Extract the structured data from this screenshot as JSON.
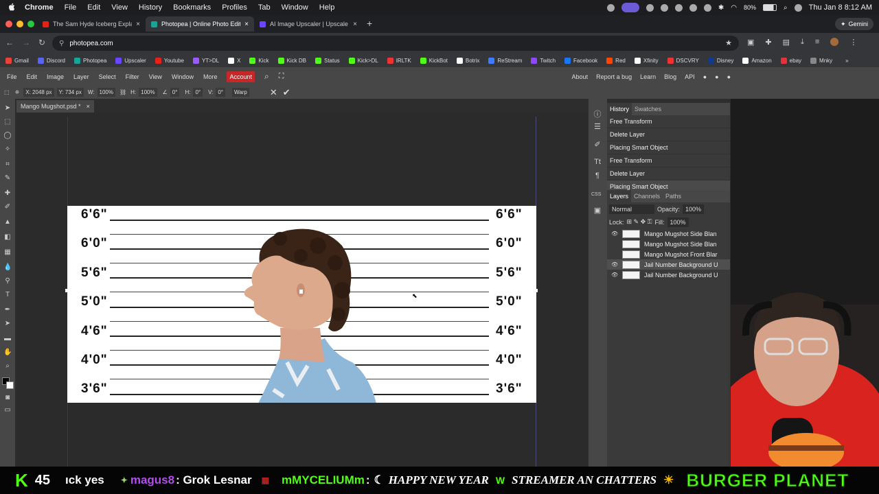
{
  "mac_menubar": {
    "app": "Chrome",
    "items": [
      "File",
      "Edit",
      "View",
      "History",
      "Bookmarks",
      "Profiles",
      "Tab",
      "Window",
      "Help"
    ],
    "battery": "80%",
    "clock": "Thu Jan 8  8:12 AM"
  },
  "browser": {
    "tabs": [
      {
        "label": "The Sam Hyde Iceberg Explai",
        "active": false
      },
      {
        "label": "Photopea | Online Photo Edito",
        "active": true
      },
      {
        "label": "AI Image Upscaler | Upscale i",
        "active": false
      }
    ],
    "new_tab": "+",
    "gemini_label": "Gemini",
    "url": "photopea.com",
    "bookmarks": [
      "Gmail",
      "Discord",
      "Photopea",
      "Upscaler",
      "Youtube",
      "YT>DL",
      "X",
      "Kick",
      "Kick DB",
      "Status",
      "Kick>DL",
      "IRLTK",
      "KickBot",
      "Botrix",
      "ReStream",
      "Twitch",
      "Facebook",
      "Red",
      "Xfinity",
      "DSCVRY",
      "Disney",
      "Amazon",
      "ebay",
      "Mnky"
    ]
  },
  "photopea": {
    "menu": [
      "File",
      "Edit",
      "Image",
      "Layer",
      "Select",
      "Filter",
      "View",
      "Window",
      "More"
    ],
    "account_label": "Account",
    "right_menu": [
      "About",
      "Report a bug",
      "Learn",
      "Blog",
      "API"
    ],
    "options": {
      "x": "X: 2048 px",
      "y": "Y: 734 px",
      "w_label": "W:",
      "w": "100%",
      "h_label": "H:",
      "h": "100%",
      "rot": "0°",
      "skew_h_label": "H:",
      "skew_h": "0°",
      "skew_v_label": "V:",
      "skew_v": "0°",
      "warp": "Warp"
    },
    "doc_tab": "Mango Mugshot.psd *",
    "doc_close": "×",
    "height_labels": [
      "6'6\"",
      "6'0\"",
      "5'6\"",
      "5'0\"",
      "4'6\"",
      "4'0\"",
      "3'6\""
    ],
    "history": {
      "tabs": [
        "History",
        "Swatches"
      ],
      "items": [
        "Free Transform",
        "Delete Layer",
        "Placing Smart Object",
        "Free Transform",
        "Delete Layer",
        "Placing Smart Object"
      ]
    },
    "layers": {
      "tabs": [
        "Layers",
        "Channels",
        "Paths"
      ],
      "blend": "Normal",
      "opacity_label": "Opacity:",
      "opacity": "100%",
      "lock_label": "Lock:",
      "fill_label": "Fill:",
      "fill": "100%",
      "items": [
        {
          "name": "Mango Mugshot Side Blan",
          "visible": true
        },
        {
          "name": "Mango Mugshot Side Blan",
          "visible": false
        },
        {
          "name": "Mango Mugshot Front Blar",
          "visible": false
        },
        {
          "name": "Jail Number Background U",
          "visible": true
        },
        {
          "name": "Jail Number Background U",
          "visible": true
        }
      ]
    }
  },
  "stream_bar": {
    "count": "45",
    "messages": [
      "ıck yes",
      "magus8",
      ": Grok Lesnar",
      "mMYCELIUMm",
      ":",
      "HAPPY NEW YEAR",
      "STREAMER AN CHATTERS"
    ],
    "brand": "BURGER PLANET"
  },
  "colors": {
    "accent_red": "#c62828",
    "kick_green": "#53fc18",
    "stream_purple": "#b44cf0"
  }
}
